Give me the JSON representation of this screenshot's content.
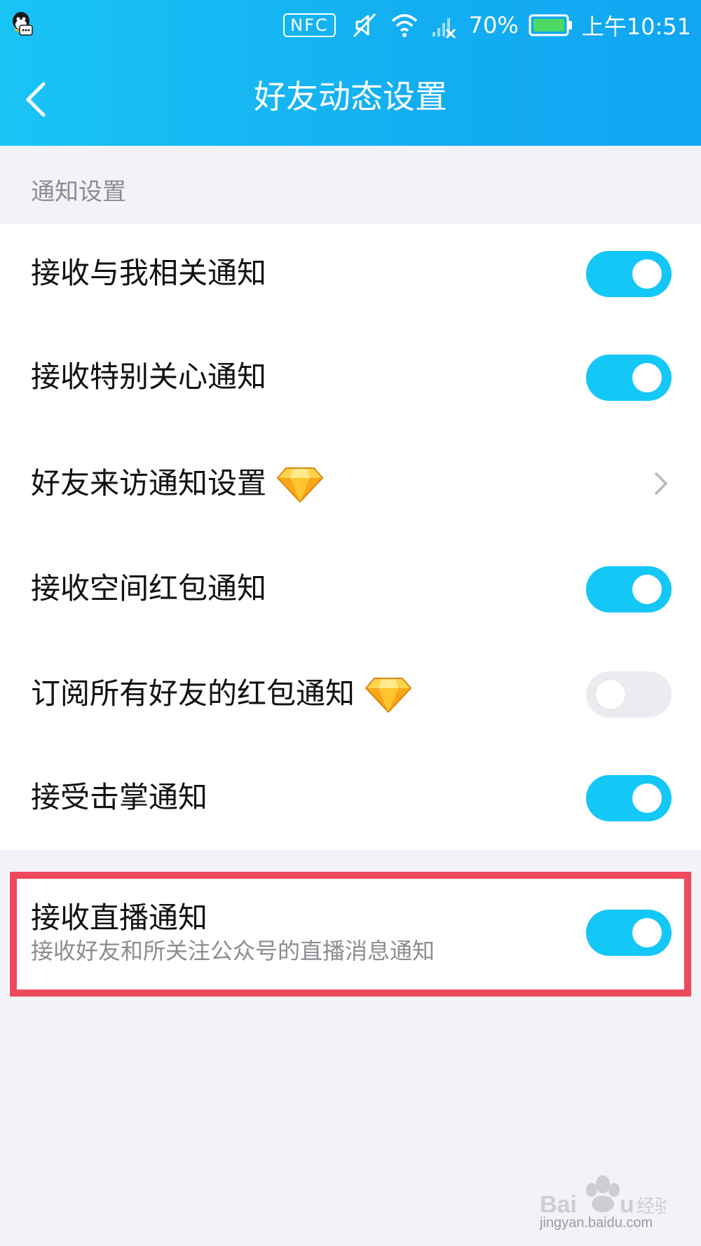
{
  "status_bar": {
    "nfc_label": "NFC",
    "battery_percent": "70%",
    "time": "上午10:51",
    "icons": [
      "qq-notification-icon",
      "mute-icon",
      "wifi-icon",
      "signal-off-icon",
      "battery-icon"
    ]
  },
  "header": {
    "title": "好友动态设置",
    "back_icon": "chevron-left-icon"
  },
  "section": {
    "label": "通知设置"
  },
  "items": [
    {
      "label": "接收与我相关通知",
      "control": "toggle",
      "state": true
    },
    {
      "label": "接收特别关心通知",
      "control": "toggle",
      "state": true
    },
    {
      "label": "好友来访通知设置",
      "control": "chevron",
      "badge_icon": "diamond-icon"
    },
    {
      "label": "接收空间红包通知",
      "control": "toggle",
      "state": true
    },
    {
      "label": "订阅所有好友的红包通知",
      "control": "toggle",
      "state": false,
      "badge_icon": "diamond-icon"
    },
    {
      "label": "接受击掌通知",
      "control": "toggle",
      "state": true
    }
  ],
  "live_notification": {
    "title": "接收直播通知",
    "subtitle": "接收好友和所关注公众号的直播消息通知",
    "state": true
  },
  "colors": {
    "header_gradient_start": "#19c4f5",
    "header_gradient_end": "#10a6f2",
    "toggle_on": "#13c7f7",
    "toggle_off": "#ececf0",
    "highlight": "#ee4a5b",
    "background": "#f2f2f7"
  },
  "watermark": {
    "text": "jingyan.baidu.com"
  }
}
